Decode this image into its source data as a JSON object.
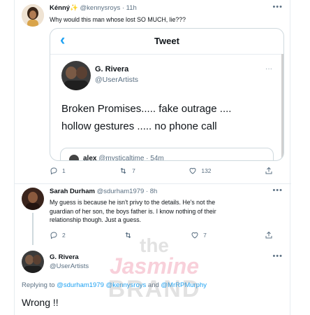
{
  "tweet1": {
    "display_name": "Kénný✨",
    "handle": "@kennysroys",
    "time": "· 11h",
    "text": "Why would this man whose lost SO MUCH, lie???",
    "reply_count": "1",
    "retweet_count": "7",
    "like_count": "132"
  },
  "quote": {
    "back_label": "‹",
    "title": "Tweet",
    "name": "G. Rivera",
    "handle": "@UserArtists",
    "more": "···",
    "line1": "Broken Promises..... fake outrage ....",
    "line2": "hollow gestures ..... no phone call",
    "nested_name": "alex",
    "nested_handle": "@mysticaltime · 54m"
  },
  "tweet2": {
    "display_name": "Sarah Durham",
    "handle": "@sdurham1979",
    "time": "· 8h",
    "line1": "My guess is because he isn't privy to the details. He's not the",
    "line2": "guardian of her son, the boys father is. I know nothing of their",
    "line3": "relationship though. Just a guess.",
    "reply_count": "2",
    "like_count": "7"
  },
  "tweet3": {
    "display_name": "G. Rivera",
    "handle": "@UserArtists",
    "replying_prefix": "Replying to",
    "mention1": "@sdurham1979",
    "mention2": "@kennysroys",
    "and": "and",
    "mention3": "@MrRPMurphy",
    "text": "Wrong !!"
  },
  "watermark": {
    "line1": "the",
    "line2": "Jasmine",
    "line3": "BRAND"
  },
  "colors": {
    "accent": "#1da1f2",
    "muted": "#5b7083",
    "border": "#e6ecf0"
  }
}
